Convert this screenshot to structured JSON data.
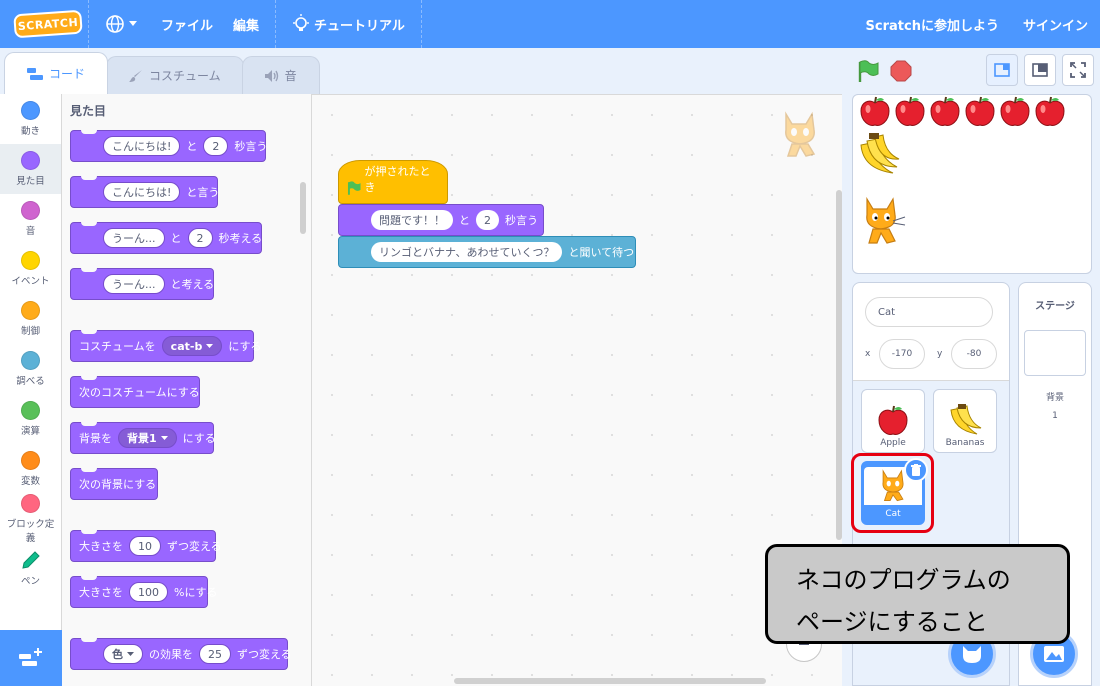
{
  "menubar": {
    "logo": "SCRATCH",
    "file": "ファイル",
    "edit": "編集",
    "tutorials": "チュートリアル",
    "join": "Scratchに参加しよう",
    "signin": "サインイン"
  },
  "tabs": {
    "code": "コード",
    "costumes": "コスチューム",
    "sounds": "音"
  },
  "categories": [
    {
      "label": "動き",
      "color": "#4c97ff"
    },
    {
      "label": "見た目",
      "color": "#9966ff"
    },
    {
      "label": "音",
      "color": "#cf63cf"
    },
    {
      "label": "イベント",
      "color": "#ffd500"
    },
    {
      "label": "制御",
      "color": "#ffab19"
    },
    {
      "label": "調べる",
      "color": "#5cb1d6"
    },
    {
      "label": "演算",
      "color": "#59c059"
    },
    {
      "label": "変数",
      "color": "#ff8c1a"
    },
    {
      "label": "ブロック定義",
      "color": "#ff6680"
    },
    {
      "label": "ペン",
      "color": "#0fbd8c"
    }
  ],
  "palette": {
    "title": "見た目",
    "say_for": {
      "text": "こんにちは!",
      "mid": "と",
      "secs": "2",
      "tail": "秒言う"
    },
    "say": {
      "text": "こんにちは!",
      "tail": "と言う"
    },
    "think_for": {
      "text": "うーん...",
      "mid": "と",
      "secs": "2",
      "tail": "秒考える"
    },
    "think": {
      "text": "うーん...",
      "tail": "と考える"
    },
    "switch_costume": {
      "head": "コスチュームを",
      "value": "cat-b",
      "tail": "にする"
    },
    "next_costume": "次のコスチュームにする",
    "switch_backdrop": {
      "head": "背景を",
      "value": "背景1",
      "tail": "にする"
    },
    "next_backdrop": "次の背景にする",
    "change_size": {
      "head": "大きさを",
      "value": "10",
      "tail": "ずつ変える"
    },
    "set_size": {
      "head": "大きさを",
      "value": "100",
      "tail": "%にする"
    },
    "change_effect": {
      "value": "色",
      "mid": "の効果を",
      "amount": "25",
      "tail": "ずつ変える"
    }
  },
  "script": {
    "hat": "が押されたとき",
    "say_for": {
      "text": "問題です！！",
      "mid": "と",
      "secs": "2",
      "tail": "秒言う"
    },
    "ask": {
      "text": "リンゴとバナナ、あわせていくつ？",
      "tail": "と聞いて待つ"
    }
  },
  "sprite": {
    "name": "Cat",
    "x_label": "x",
    "x": "-170",
    "y_label": "y",
    "y": "-80"
  },
  "sprites": [
    {
      "name": "Apple"
    },
    {
      "name": "Bananas"
    },
    {
      "name": "Cat"
    }
  ],
  "stage_pane": {
    "title": "ステージ",
    "backdrops_label": "背景",
    "backdrops_count": "1"
  },
  "callout": {
    "line1": "ネコのプログラムの",
    "line2": "ページにすること"
  },
  "colors": {
    "accent": "#4c97ff",
    "looks": "#9966ff",
    "events": "#ffbf00",
    "sensing": "#5cb1d6",
    "highlight": "#e60012"
  }
}
